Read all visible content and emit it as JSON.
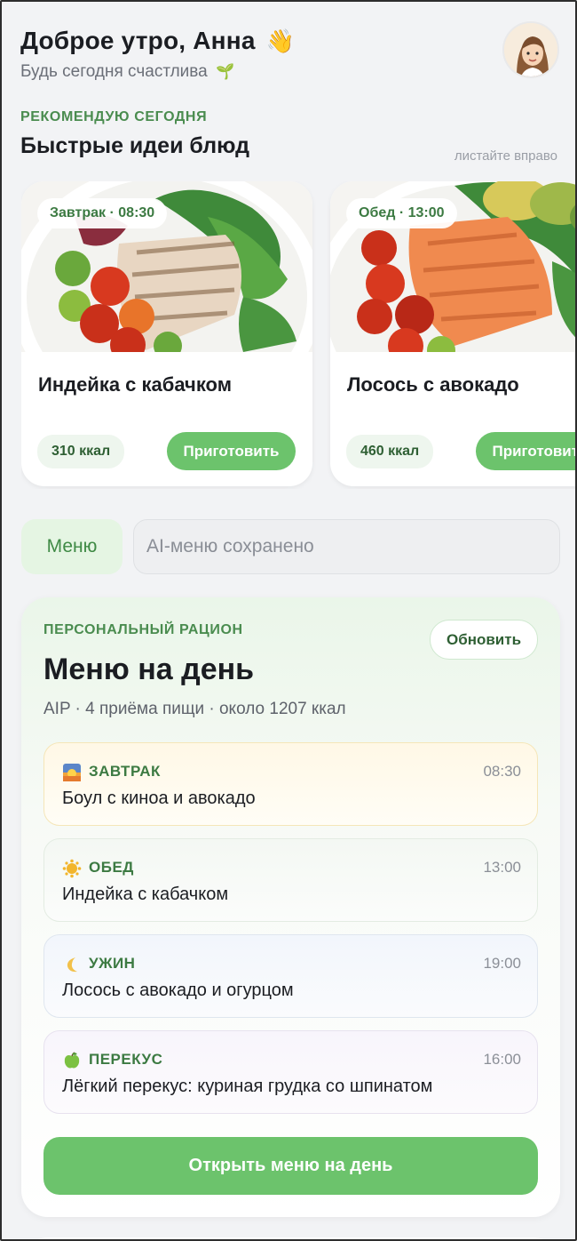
{
  "header": {
    "greeting": "Доброе утро, Анна",
    "greeting_emoji": "👋",
    "subtitle": "Будь сегодня счастлива",
    "subtitle_emoji": "🌱"
  },
  "recommend": {
    "eyebrow": "РЕКОМЕНДУЮ СЕГОДНЯ",
    "title": "Быстрые идеи блюд",
    "hint": "листайте вправо",
    "cards": [
      {
        "time": "Завтрак · 08:30",
        "title": "Индейка с кабачком",
        "kcal": "310 ккал",
        "button": "Приготовить"
      },
      {
        "time": "Обед · 13:00",
        "title": "Лосось с авокадо",
        "kcal": "460 ккал",
        "button": "Приготовить"
      }
    ]
  },
  "menu_row": {
    "tab_label": "Меню",
    "input_placeholder": "AI-меню сохранено"
  },
  "daily": {
    "eyebrow": "ПЕРСОНАЛЬНЫЙ РАЦИОН",
    "refresh_label": "Обновить",
    "title": "Меню на день",
    "subtitle": "AIP · 4 приёма пищи · около 1207 ккал",
    "meals": [
      {
        "icon": "sunrise-icon",
        "label": "ЗАВТРАК",
        "time": "08:30",
        "name": "Боул с киноа и авокадо"
      },
      {
        "icon": "sun-icon",
        "label": "ОБЕД",
        "time": "13:00",
        "name": "Индейка с кабачком"
      },
      {
        "icon": "moon-icon",
        "label": "УЖИН",
        "time": "19:00",
        "name": "Лосось с авокадо и огурцом"
      },
      {
        "icon": "apple-icon",
        "label": "ПЕРЕКУС",
        "time": "16:00",
        "name": "Лёгкий перекус: куриная грудка со шпинатом"
      }
    ],
    "open_button": "Открыть меню на день"
  },
  "colors": {
    "accent": "#6cc36c",
    "accent_text": "#4a8c4f",
    "background": "#f2f3f5"
  }
}
